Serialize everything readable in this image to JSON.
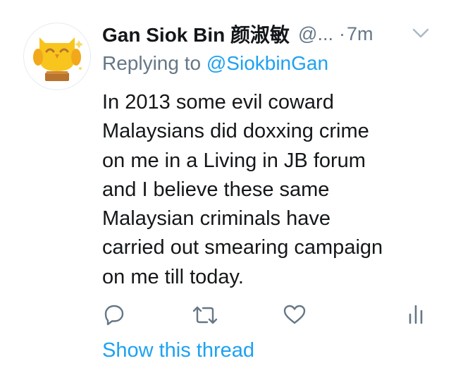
{
  "tweet": {
    "author_name": "Gan Siok Bin 颜淑敏",
    "handle": "@...",
    "separator": "·",
    "time": "7m",
    "replying_prefix": "Replying to",
    "replying_to": "@SiokbinGan",
    "text_lines": [
      "In 2013 some evil coward",
      "Malaysians did doxxing crime",
      "on me in a Living in JB forum",
      "and I believe these same",
      "Malaysian criminals have",
      "carried out smearing campaign",
      "on me till today."
    ],
    "show_thread_label": "Show this thread"
  },
  "icons": {
    "avatar": "yellow-owl-trophy",
    "menu": "chevron-down-icon",
    "reply": "reply-icon",
    "retweet": "retweet-icon",
    "like": "heart-icon",
    "analytics": "analytics-icon"
  },
  "colors": {
    "text": "#14171a",
    "secondary": "#657786",
    "link": "#1da1f2",
    "avatar_yellow": "#f7c51e"
  }
}
